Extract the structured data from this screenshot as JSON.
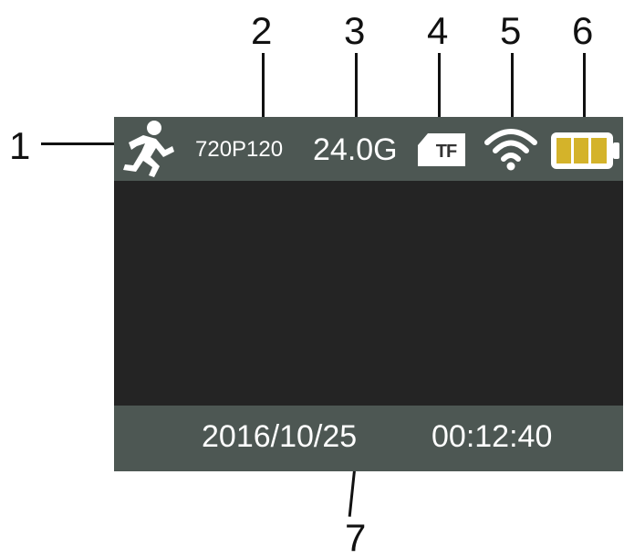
{
  "callouts": [
    "1",
    "2",
    "3",
    "4",
    "5",
    "6",
    "7"
  ],
  "status_bar": {
    "resolution": "720P120",
    "capacity": "24.0G",
    "card_label": "TF",
    "mode_icon": "running-person-icon",
    "wifi_icon": "wifi-icon",
    "battery_icon": "battery-icon"
  },
  "footer": {
    "date": "2016/10/25",
    "time": "00:12:40"
  },
  "colors": {
    "bar": "#4d5753",
    "screen": "#242424",
    "battery_fill": "#d4b32a"
  }
}
